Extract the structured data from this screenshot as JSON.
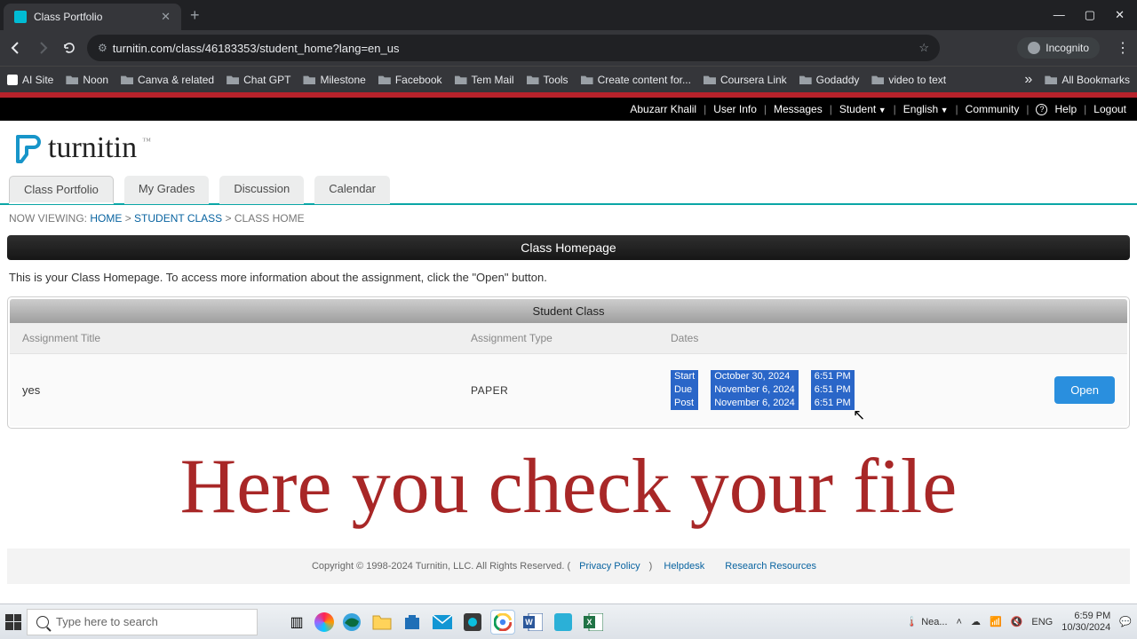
{
  "browser": {
    "tab_title": "Class Portfolio",
    "url": "turnitin.com/class/46183353/student_home?lang=en_us",
    "incognito": "Incognito"
  },
  "bookmarks": [
    "AI Site",
    "Noon",
    "Canva & related",
    "Chat GPT",
    "Milestone",
    "Facebook",
    "Tem Mail",
    "Tools",
    "Create content for...",
    "Coursera Link",
    "Godaddy",
    "video to text"
  ],
  "bookmarks_all": "All Bookmarks",
  "topnav": {
    "user": "Abuzarr Khalil",
    "userinfo": "User Info",
    "messages": "Messages",
    "role": "Student",
    "lang": "English",
    "community": "Community",
    "help": "Help",
    "logout": "Logout"
  },
  "logo_text": "turnitin",
  "page_tabs": [
    "Class Portfolio",
    "My Grades",
    "Discussion",
    "Calendar"
  ],
  "breadcrumb": {
    "prefix": "NOW VIEWING:",
    "home": "HOME",
    "sep": ">",
    "student_class": "STUDENT CLASS",
    "class_home": "CLASS HOME"
  },
  "section_title": "Class Homepage",
  "intro": "This is your Class Homepage. To access more information about the assignment, click the \"Open\" button.",
  "table_title": "Student Class",
  "cols": {
    "title": "Assignment Title",
    "type": "Assignment Type",
    "dates": "Dates"
  },
  "row": {
    "title": "yes",
    "type": "PAPER",
    "labels": [
      "Start",
      "Due",
      "Post"
    ],
    "dates": [
      "October 30, 2024",
      "November 6, 2024",
      "November 6, 2024"
    ],
    "times": [
      "6:51 PM",
      "6:51 PM",
      "6:51 PM"
    ],
    "open": "Open"
  },
  "overlay": "Here you check your file",
  "footer": {
    "copy": "Copyright © 1998-2024 Turnitin, LLC. All Rights Reserved. (",
    "privacy": "Privacy Policy",
    "close": ")",
    "helpdesk": "Helpdesk",
    "research": "Research Resources"
  },
  "taskbar": {
    "search_placeholder": "Type here to search",
    "weather": "Nea...",
    "lang": "ENG",
    "time": "6:59 PM",
    "date": "10/30/2024"
  }
}
